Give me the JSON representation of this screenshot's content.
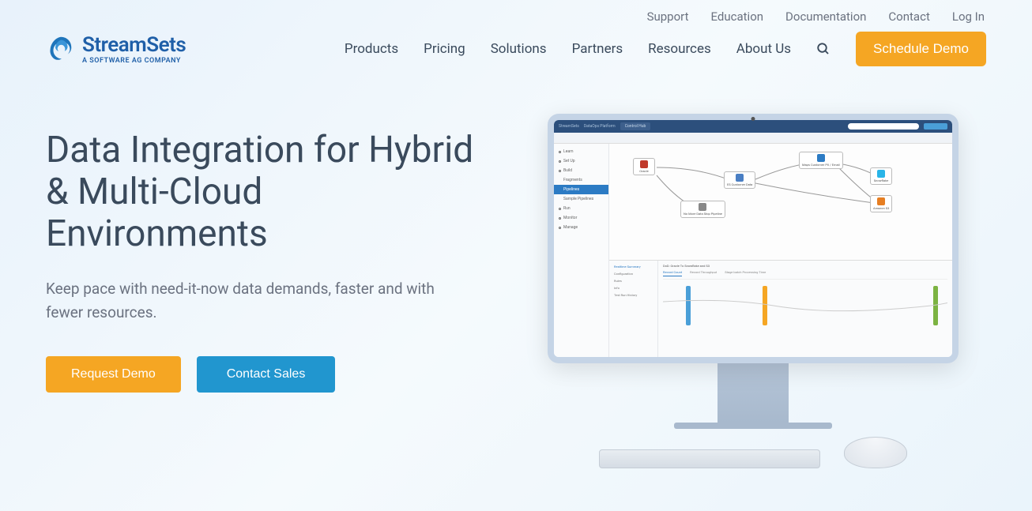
{
  "topNav": {
    "support": "Support",
    "education": "Education",
    "documentation": "Documentation",
    "contact": "Contact",
    "login": "Log In"
  },
  "logo": {
    "name": "StreamSets",
    "tagline": "A SOFTWARE AG COMPANY"
  },
  "mainNav": {
    "products": "Products",
    "pricing": "Pricing",
    "solutions": "Solutions",
    "partners": "Partners",
    "resources": "Resources",
    "about": "About Us"
  },
  "cta": "Schedule Demo",
  "hero": {
    "title": "Data Integration for Hybrid & Multi-Cloud Environments",
    "subtitle": "Keep pace with need-it-now data demands, faster and with fewer resources.",
    "btnDemo": "Request Demo",
    "btnSales": "Contact Sales"
  },
  "app": {
    "brand": "StreamSets",
    "platform": "DataOps Platform",
    "hub": "Control Hub",
    "sidebar": [
      "Learn",
      "Set Up",
      "Build",
      "Fragments",
      "Pipelines",
      "Sample Pipelines",
      "Run",
      "Monitor",
      "Manage"
    ],
    "nodes": {
      "oracle": "Oracle",
      "customerData": "ES Customer Data",
      "noMore": "No More Data Stop Pipeline",
      "mapCustomer": "Maps Customer PII / Email",
      "snowflake": "Snowflake",
      "amazonS3": "Amazon S3"
    },
    "bottomTitle": "DoD: Oracle To Snowflake and S3",
    "bottomSide": [
      "Realtime Summary",
      "Configuration",
      "Rules",
      "Info",
      "Test Run History"
    ],
    "bottomTabs": [
      "Record Count",
      "Record Throughput",
      "Stage batch Processing Time"
    ]
  }
}
